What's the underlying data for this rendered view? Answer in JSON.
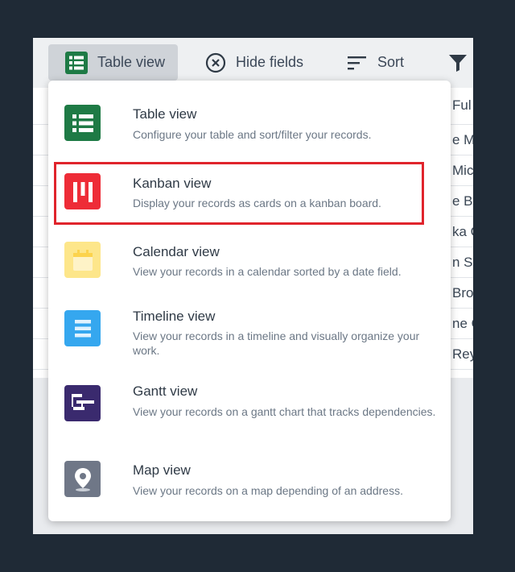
{
  "toolbar": {
    "table_view_label": "Table view",
    "hide_fields_label": "Hide fields",
    "sort_label": "Sort"
  },
  "grid": {
    "partial_cells": [
      "Ful",
      "e Mo",
      "Mich",
      "e Bir",
      "ka C",
      "n Sh",
      "Broo",
      "ne C",
      "Reyn"
    ]
  },
  "menu": {
    "items": [
      {
        "title": "Table view",
        "description": "Configure your table and sort/filter your records.",
        "icon": "table-grid-icon",
        "color": "#1e7a45"
      },
      {
        "title": "Kanban view",
        "description": "Display your records as cards on a kanban board.",
        "icon": "kanban-icon",
        "color": "#ee2c37"
      },
      {
        "title": "Calendar view",
        "description": "View your records in a calendar sorted by a date field.",
        "icon": "calendar-icon",
        "color": "#fde68a"
      },
      {
        "title": "Timeline view",
        "description": "View your records in a timeline and visually organize your work.",
        "icon": "timeline-icon",
        "color": "#35a7ef"
      },
      {
        "title": "Gantt view",
        "description": "View your records on a gantt chart that tracks dependencies.",
        "icon": "gantt-icon",
        "color": "#3a2a6e"
      },
      {
        "title": "Map view",
        "description": "View your records on a map depending of an address.",
        "icon": "map-pin-icon",
        "color": "#6f7787"
      }
    ],
    "selected_item": "Kanban view",
    "highlight_color": "#e0242c"
  }
}
